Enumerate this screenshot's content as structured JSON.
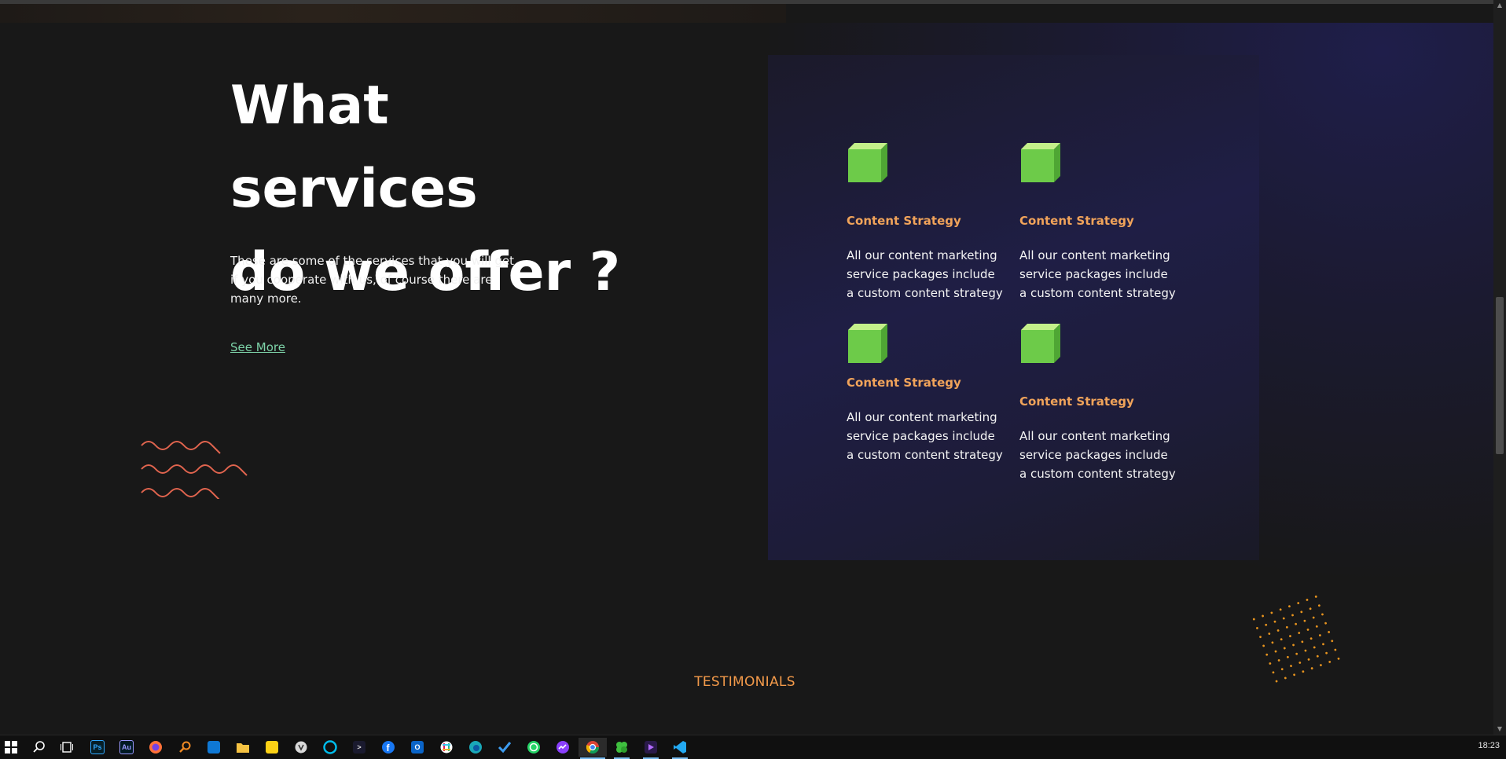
{
  "hero": {
    "title_line1": "What services",
    "title_line2": "do we offer ?",
    "description": "These are some of the services that you will get if you cooperate with us, of course there are many more.",
    "see_more_label": "See More"
  },
  "services": {
    "items": [
      {
        "title": "Content Strategy",
        "description": "All our content marketing service packages include a custom content strategy",
        "icon": "green-cube-icon"
      },
      {
        "title": "Content Strategy",
        "description": "All our content marketing service packages include a custom content strategy",
        "icon": "green-cube-icon"
      },
      {
        "title": "Content Strategy",
        "description": "All our content marketing service packages include a custom content strategy",
        "icon": "green-cube-icon"
      },
      {
        "title": "Content Strategy",
        "description": "All our content marketing service packages include a custom content strategy",
        "icon": "green-cube-icon"
      }
    ]
  },
  "testimonials": {
    "label": "TESTIMONIALS"
  },
  "colors": {
    "background": "#181818",
    "accent_orange": "#f0a35a",
    "link_green": "#7dd3a8",
    "wave_red": "#e0644e",
    "cube_green": "#6dcb49",
    "panel_indigo": "#1f1e45"
  },
  "taskbar": {
    "items": [
      {
        "name": "windows-start-icon"
      },
      {
        "name": "search-icon"
      },
      {
        "name": "task-view-icon"
      },
      {
        "name": "photoshop-icon",
        "glyph": "Ps"
      },
      {
        "name": "audition-icon",
        "glyph": "Au"
      },
      {
        "name": "firefox-icon"
      },
      {
        "name": "search-tool-icon"
      },
      {
        "name": "store-icon"
      },
      {
        "name": "file-explorer-icon"
      },
      {
        "name": "sticky-notes-icon"
      },
      {
        "name": "app-icon"
      },
      {
        "name": "webex-icon"
      },
      {
        "name": "terminal-icon",
        "glyph": ">"
      },
      {
        "name": "facebook-icon",
        "glyph": "f"
      },
      {
        "name": "outlook-icon"
      },
      {
        "name": "slack-icon"
      },
      {
        "name": "edge-icon"
      },
      {
        "name": "todo-icon"
      },
      {
        "name": "whatsapp-icon"
      },
      {
        "name": "messenger-icon"
      },
      {
        "name": "chrome-icon"
      },
      {
        "name": "clover-icon"
      },
      {
        "name": "video-editor-icon"
      },
      {
        "name": "vscode-icon"
      }
    ],
    "clock": "18:23"
  }
}
